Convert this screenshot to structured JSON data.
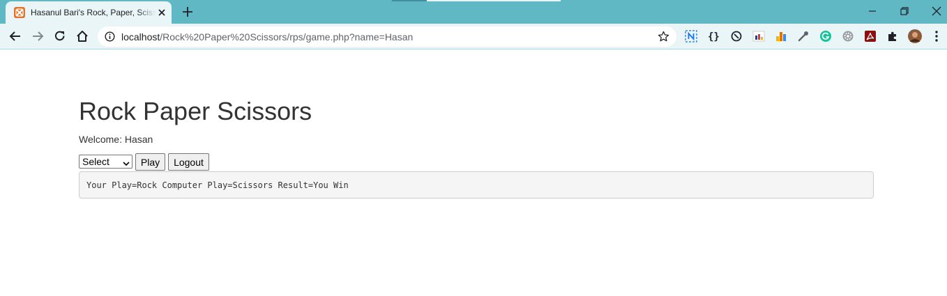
{
  "browser": {
    "tab": {
      "title": "Hasanul Bari's Rock, Paper, Scissors",
      "favicon": "xampp-icon"
    },
    "address_bar": {
      "host": "localhost",
      "path": "/Rock%20Paper%20Scissors/rps/game.php?name=Hasan"
    },
    "extensions": [
      "grammarly-n-icon",
      "json-braces-icon",
      "sync-icon",
      "flag-chart-icon",
      "bar-chart-icon",
      "eyedropper-icon",
      "grammarly-icon",
      "gear-badge-icon",
      "pdf-icon",
      "puzzle-extensions-icon",
      "profile-avatar",
      "kebab-menu-icon"
    ],
    "colors": {
      "frame": "#5fb8c4",
      "toolbar": "#e9f5f7"
    }
  },
  "page": {
    "title": "Rock Paper Scissors",
    "welcome_label": "Welcome:",
    "user_name": "Hasan",
    "welcome_text": "Welcome: Hasan",
    "select": {
      "selected": "Select"
    },
    "buttons": {
      "play": "Play",
      "logout": "Logout"
    },
    "result": "Your Play=Rock Computer Play=Scissors Result=You Win"
  }
}
